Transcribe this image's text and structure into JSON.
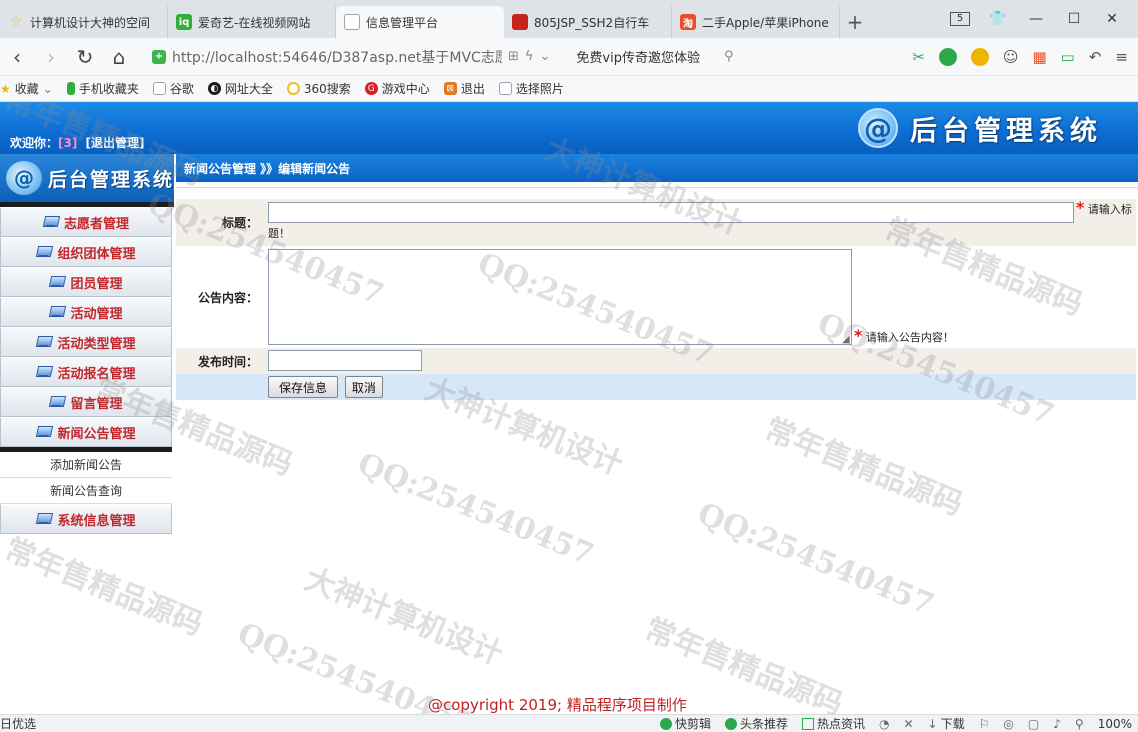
{
  "browser": {
    "tabs": [
      {
        "label": "计算机设计大神的空间",
        "fav_color": "#f0c020",
        "fav_glyph": "☆",
        "active": false
      },
      {
        "label": "爱奇艺-在线视频网站",
        "fav_color": "#2fae3a",
        "fav_glyph": "iq",
        "active": false
      },
      {
        "label": "信息管理平台",
        "fav_color": "#9aa3ad",
        "fav_glyph": "□",
        "active": true
      },
      {
        "label": "805JSP_SSH2自行车",
        "fav_color": "#c8241c",
        "fav_glyph": "■",
        "active": false
      },
      {
        "label": "二手Apple/苹果iPhone",
        "fav_color": "#e8502a",
        "fav_glyph": "淘",
        "active": false
      }
    ],
    "new_tab_icon": "+",
    "tab_count_badge": "5",
    "address": {
      "url": "http://localhost:54646/D387asp.net基于MVC志愿",
      "promo_text": "免费vip传奇邀您体验"
    },
    "bookmarks": [
      {
        "label": "收藏",
        "icon": "star-icon",
        "color": "#f0b400"
      },
      {
        "label": "手机收藏夹",
        "icon": "phone-icon",
        "color": "#2fae3a"
      },
      {
        "label": "谷歌",
        "icon": "page-icon",
        "color": "#9aa3ad"
      },
      {
        "label": "网址大全",
        "icon": "globe-icon",
        "color": "#1c1c1c"
      },
      {
        "label": "360搜索",
        "icon": "search-ring-icon",
        "color": "#f0c020"
      },
      {
        "label": "游戏中心",
        "icon": "game-icon",
        "color": "#d81e1e"
      },
      {
        "label": "退出",
        "icon": "exit-icon",
        "color": "#e07a20"
      },
      {
        "label": "选择照片",
        "icon": "page-icon",
        "color": "#9aa3ad"
      }
    ]
  },
  "header": {
    "welcome_prefix": "欢迎你：",
    "user_name": "[3]",
    "logout_label": "[退出管理]",
    "logo_text": "后台管理系统",
    "logo_mark": "@"
  },
  "sidebar": {
    "title": "后台管理系统",
    "items": [
      {
        "label": "志愿者管理"
      },
      {
        "label": "组织团体管理"
      },
      {
        "label": "团员管理"
      },
      {
        "label": "活动管理"
      },
      {
        "label": "活动类型管理"
      },
      {
        "label": "活动报名管理"
      },
      {
        "label": "留言管理"
      },
      {
        "label": "新闻公告管理"
      }
    ],
    "sub_items": [
      {
        "label": "添加新闻公告"
      },
      {
        "label": "新闻公告查询"
      }
    ],
    "last_item": {
      "label": "系统信息管理"
    }
  },
  "main": {
    "breadcrumb": "新闻公告管理 》》编辑新闻公告",
    "form": {
      "title_label": "标题：",
      "title_value": "",
      "title_required": "*",
      "title_hint_line1": "请输入标",
      "title_hint_line2": "题！",
      "content_label": "公告内容：",
      "content_value": "",
      "content_required": "*",
      "content_hint": "请输入公告内容！",
      "date_label": "发布时间：",
      "date_value": "",
      "save_label": "保存信息",
      "cancel_label": "取消"
    },
    "copyright": "@copyright 2019; 精品程序项目制作"
  },
  "statusbar": {
    "left_text": "日优选",
    "items": [
      {
        "label": "快剪辑"
      },
      {
        "label": "头条推荐"
      },
      {
        "label": "热点资讯"
      },
      {
        "label": "下载"
      }
    ],
    "zoom": "100%"
  },
  "watermark": {
    "qq": "QQ:254540457",
    "line_a": "大神计算机设计",
    "line_b": "常年售精品源码"
  },
  "colors": {
    "banner_blue": "#0d6ed5",
    "menu_text_red": "#c0282c",
    "required_red": "#d81e1e",
    "row_beige": "#f2efe9",
    "row_blue": "#d6e8f8"
  }
}
